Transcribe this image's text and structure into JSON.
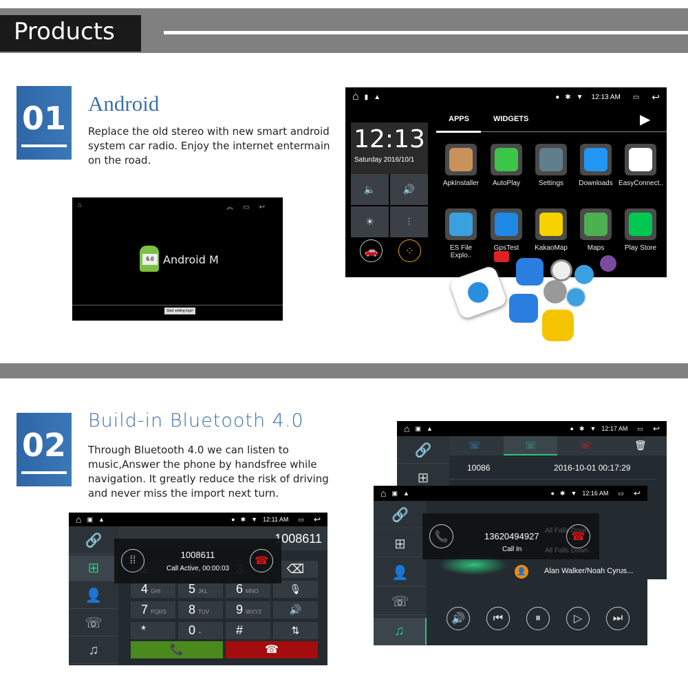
{
  "header": {
    "title": "Products"
  },
  "sections": [
    {
      "number": "01",
      "title": "Android",
      "description": "Replace the old stereo with new smart android system car radio. Enjoy the internet entermain on the road."
    },
    {
      "number": "02",
      "title": "Build-in Bluetooth 4.0",
      "description": "Through Bluetooth 4.0 we can listen to music,Answer the phone by handsfree while navigation. It greatly reduce the risk of driving and never miss the import next turn."
    }
  ],
  "boot_screen": {
    "logo_text": "Android M",
    "version_badge": "6.0",
    "button": "Start setting logo!"
  },
  "launcher": {
    "time_status": "12:13 AM",
    "clock": "12:13",
    "date": "Saturday 2016/10/1",
    "tabs": [
      "APPS",
      "WIDGETS"
    ],
    "apps": [
      {
        "label": "ApkInstaller",
        "color": "#c8935a"
      },
      {
        "label": "AutoPlay",
        "color": "#3dc44a"
      },
      {
        "label": "Settings",
        "color": "#607d8b"
      },
      {
        "label": "Downloads",
        "color": "#2196f3"
      },
      {
        "label": "EasyConnect..",
        "color": "#ffffff"
      },
      {
        "label": "ES File Explo..",
        "color": "#3aa0e0"
      },
      {
        "label": "GpsTest",
        "color": "#1e88e5"
      },
      {
        "label": "KakaoMap",
        "color": "#f5d200"
      },
      {
        "label": "Maps",
        "color": "#4caf50"
      },
      {
        "label": "Play Store",
        "color": "#00c853"
      }
    ]
  },
  "dialer": {
    "time_status": "12:11 AM",
    "number": "1008611",
    "popup_number": "1008611",
    "popup_status": "Call Active, 00:00:03",
    "keys": [
      [
        "1",
        ""
      ],
      [
        "2",
        ""
      ],
      [
        "3",
        ""
      ],
      [
        "4",
        "GHI"
      ],
      [
        "5",
        "JKL"
      ],
      [
        "6",
        "MNO"
      ],
      [
        "7",
        "PQRS"
      ],
      [
        "8",
        "TUV"
      ],
      [
        "9",
        "WXYZ"
      ],
      [
        "*",
        ""
      ],
      [
        "0",
        "+"
      ],
      [
        "#",
        ""
      ]
    ]
  },
  "call_log": {
    "time_status": "12:17 AM",
    "entry_number": "10086",
    "entry_time": "2016-10-01 00:17:29"
  },
  "music_call": {
    "time_status": "12:16 AM",
    "caller": "13620494927",
    "status": "Call In",
    "song_title": "All Falls Down",
    "song_title_2": "All Falls Down",
    "artist": "Alan Walker/Noah Cyrus..."
  },
  "colors": {
    "accent_blue": "#3a6fa8",
    "band_gray": "#808080",
    "call_green": "#4a8a1c",
    "call_red": "#a30d0d",
    "teal": "#2ec27e"
  }
}
